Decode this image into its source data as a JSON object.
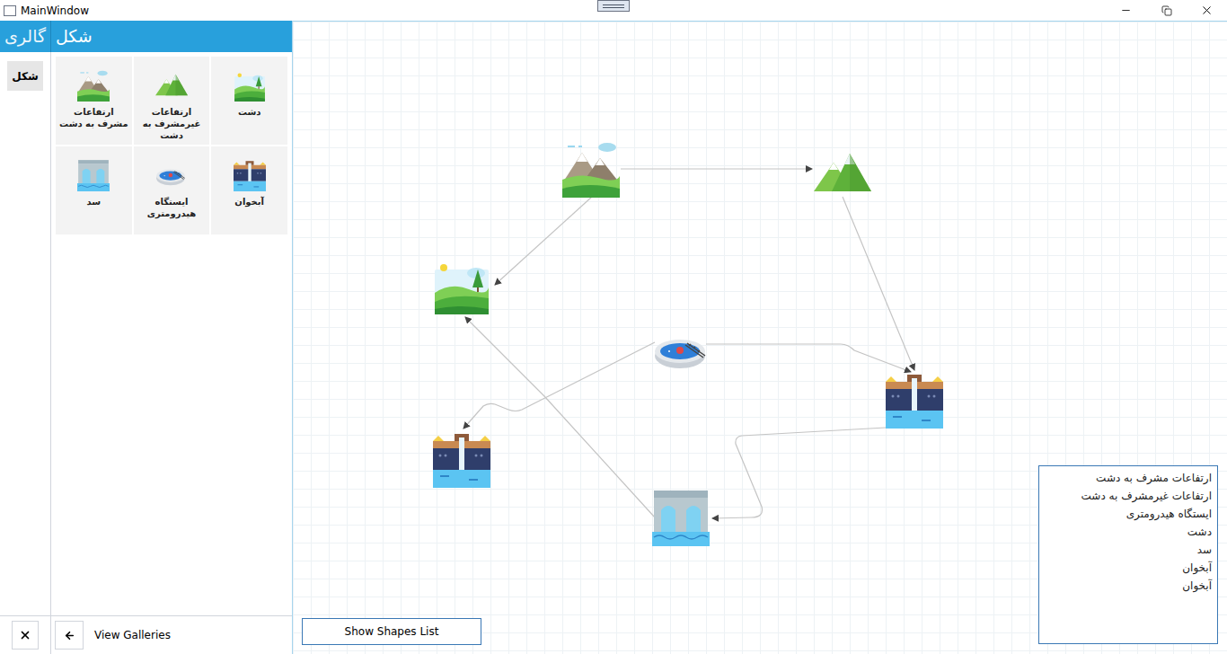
{
  "window": {
    "title": "MainWindow"
  },
  "header": {
    "tabs": [
      {
        "label": "گالری",
        "selected": false
      },
      {
        "label": "شکل",
        "selected": true
      }
    ]
  },
  "side_tabs": [
    {
      "label": "شکل",
      "selected": true
    }
  ],
  "gallery": [
    {
      "label": "دشت",
      "kind": "plain"
    },
    {
      "label": "ارتفاعات غیرمشرف به دشت",
      "kind": "mountain"
    },
    {
      "label": "ارتفاعات مشرف به دشت",
      "kind": "mountain-cloud"
    },
    {
      "label": "آبخوان",
      "kind": "aquifer"
    },
    {
      "label": "ایستگاه هیدرومتری",
      "kind": "station"
    },
    {
      "label": "سد",
      "kind": "dam"
    }
  ],
  "footer": {
    "back_label": "View Galleries"
  },
  "canvas": {
    "nodes": [
      {
        "kind": "mountain-cloud"
      },
      {
        "kind": "mountain"
      },
      {
        "kind": "plain"
      },
      {
        "kind": "station"
      },
      {
        "kind": "aquifer"
      },
      {
        "kind": "aquifer"
      },
      {
        "kind": "dam"
      }
    ],
    "edges": [
      {
        "from": 0,
        "to": 1
      },
      {
        "from": 0,
        "to": 2
      },
      {
        "from": 1,
        "to": 4
      },
      {
        "from": 3,
        "to": 4
      },
      {
        "from": 3,
        "to": 5
      },
      {
        "from": 6,
        "to": 2
      },
      {
        "from": 4,
        "to": 6
      }
    ]
  },
  "show_list_button": "Show Shapes List",
  "shapes_list": [
    "ارتفاعات مشرف به دشت",
    "ارتفاعات غیرمشرف به دشت",
    "ایستگاه هیدرومتری",
    "دشت",
    "سد",
    "آبخوان",
    "آبخوان"
  ]
}
